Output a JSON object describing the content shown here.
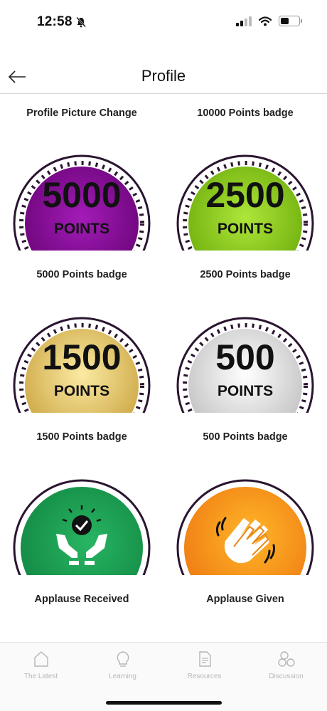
{
  "status_bar": {
    "time": "12:58"
  },
  "nav": {
    "title": "Profile"
  },
  "badges": [
    {
      "label": "Profile Picture Change"
    },
    {
      "label": "10000 Points badge"
    },
    {
      "label": "5000 Points badge",
      "number": "5000",
      "word": "POINTS",
      "color": "#8a0a9c"
    },
    {
      "label": "2500 Points badge",
      "number": "2500",
      "word": "POINTS",
      "color": "#93d01a"
    },
    {
      "label": "1500 Points badge",
      "number": "1500",
      "word": "POINTS",
      "color": "#e8c964"
    },
    {
      "label": "500 Points badge",
      "number": "500",
      "word": "POINTS",
      "color": "#d9d9d9"
    },
    {
      "label": "Applause Received",
      "color": "#1f9e55",
      "icon": "hands-check-icon"
    },
    {
      "label": "Applause Given",
      "color": "#f7931e",
      "icon": "clapping-hands-icon"
    }
  ],
  "tabs": [
    {
      "label": "The Latest",
      "icon": "home-icon"
    },
    {
      "label": "Learning",
      "icon": "lightbulb-icon"
    },
    {
      "label": "Resources",
      "icon": "document-icon"
    },
    {
      "label": "Discussion",
      "icon": "discussion-icon"
    }
  ]
}
